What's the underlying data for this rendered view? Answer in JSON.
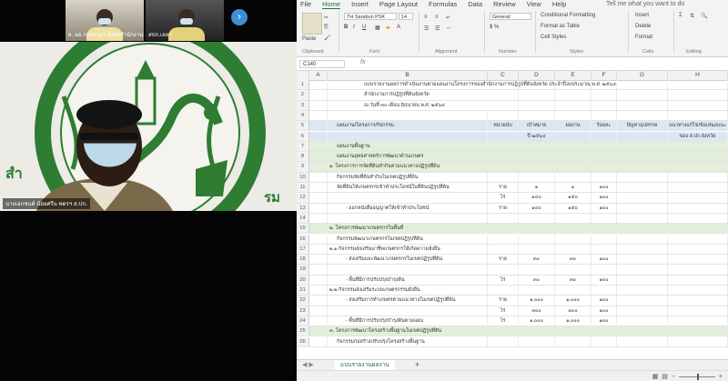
{
  "zoom": {
    "thumbs": [
      {
        "caption": "ผ. ผอ.กรมงานฯ สังกัดสำนักงานฯ"
      },
      {
        "caption": "สปก.เลยฯ"
      }
    ],
    "main_caption": "นายเอกชนค์ น้อยศรีน พดรฯ ส.ปก."
  },
  "excel": {
    "tabs": [
      "File",
      "Home",
      "Insert",
      "Page Layout",
      "Formulas",
      "Data",
      "Review",
      "View",
      "Help"
    ],
    "active_tab": "Home",
    "tell_me": "Tell me what you want to do",
    "font_name": "TH Sarabun PSK",
    "font_size": "14",
    "number_format": "General",
    "paste_label": "Paste",
    "clipboard": "Clipboard",
    "font_group": "Font",
    "alignment": "Alignment",
    "number": "Number",
    "styles": "Styles",
    "cells": "Cells",
    "editing": "Editing",
    "cond_format": "Conditional Formatting",
    "format_table": "Format as Table",
    "cell_styles": "Cell Styles",
    "insert": "Insert",
    "delete": "Delete",
    "format": "Format",
    "name_box": "C140",
    "fx": "fx",
    "columns": [
      "A",
      "B",
      "C",
      "D",
      "E",
      "F",
      "G",
      "H"
    ],
    "rows": [
      {
        "n": "1",
        "b": "แบบรายงานผลการดำเนินงานตามแผนงานโครงการของสำนักงานการปฏิรูปที่ดินจังหวัด ประจำปีงบประมาณ พ.ศ. ๒๕๖๔",
        "c": "",
        "d": "",
        "e": "",
        "f": "",
        "g": "",
        "h": "",
        "cls": ""
      },
      {
        "n": "2",
        "b": "สำนักงานการปฏิรูปที่ดินจังหวัด",
        "c": "",
        "d": "",
        "e": "",
        "f": "",
        "g": "",
        "h": "",
        "cls": ""
      },
      {
        "n": "3",
        "b": "ณ วันที่ ๓๐ เดือน มิถุนายน พ.ศ. ๒๕๖๔",
        "c": "",
        "d": "",
        "e": "",
        "f": "",
        "g": "",
        "h": "",
        "cls": ""
      },
      {
        "n": "4",
        "b": "",
        "c": "",
        "d": "",
        "e": "",
        "f": "",
        "g": "",
        "h": "",
        "cls": ""
      },
      {
        "n": "5",
        "b": "แผนงาน/โครงการ/กิจกรรม",
        "c": "หน่วยนับ",
        "d": "เป้าหมาย",
        "e": "ผลงาน",
        "f": "ร้อยละ",
        "g": "ปัญหาอุปสรรค",
        "h": "แนวทางแก้ไข/ข้อเสนอแนะ",
        "cls": "hl2"
      },
      {
        "n": "6",
        "b": "",
        "c": "",
        "d": "ปี ๒๕๖๔",
        "e": "",
        "f": "",
        "g": "",
        "h": "ของ ส.ปก.จังหวัด",
        "cls": "hl2"
      },
      {
        "n": "7",
        "b": "แผนงานพื้นฐาน",
        "c": "",
        "d": "",
        "e": "",
        "f": "",
        "g": "",
        "h": "",
        "cls": "hl"
      },
      {
        "n": "8",
        "b": "แผนงานยุทธศาสตร์การพัฒนาด้านเกษตร",
        "c": "",
        "d": "",
        "e": "",
        "f": "",
        "g": "",
        "h": "",
        "cls": "hl"
      },
      {
        "n": "9",
        "b": "๑. โครงการการจัดที่ดินทำกินตามแนวทางปฏิรูปที่ดิน",
        "c": "",
        "d": "",
        "e": "",
        "f": "",
        "g": "",
        "h": "",
        "cls": "hl"
      },
      {
        "n": "10",
        "b": "กิจกรรมจัดที่ดินทำกินในเขตปฏิรูปที่ดิน",
        "c": "",
        "d": "",
        "e": "",
        "f": "",
        "g": "",
        "h": "",
        "cls": ""
      },
      {
        "n": "11",
        "b": "จัดที่ดินให้เกษตรกรเข้าทำประโยชน์ในที่ดินปฏิรูปที่ดิน",
        "c": "ราย",
        "d": "๑",
        "e": "๑",
        "f": "๑๐๐",
        "g": "",
        "h": "",
        "cls": ""
      },
      {
        "n": "12",
        "b": "",
        "c": "ไร่",
        "d": "๑๔๐",
        "e": "๑๕๐",
        "f": "๑๐๐",
        "g": "",
        "h": "",
        "cls": ""
      },
      {
        "n": "13",
        "b": "- ออกหนังสืออนุญาตให้เข้าทำประโยชน์",
        "c": "ราย",
        "d": "๑๔๐",
        "e": "๑๕๐",
        "f": "๑๐๐",
        "g": "",
        "h": "",
        "cls": ""
      },
      {
        "n": "14",
        "b": "",
        "c": "",
        "d": "",
        "e": "",
        "f": "",
        "g": "",
        "h": "",
        "cls": ""
      },
      {
        "n": "15",
        "b": "๒. โครงการพัฒนาเกษตรกรในพื้นที่",
        "c": "",
        "d": "",
        "e": "",
        "f": "",
        "g": "",
        "h": "",
        "cls": "hl"
      },
      {
        "n": "16",
        "b": "กิจกรรมพัฒนาเกษตรกรในเขตปฏิรูปที่ดิน",
        "c": "",
        "d": "",
        "e": "",
        "f": "",
        "g": "",
        "h": "",
        "cls": ""
      },
      {
        "n": "17",
        "b": "๒.๑ กิจกรรมส่งเสริมอาชีพเกษตรกรให้เกิดความยั่งยืน",
        "c": "",
        "d": "",
        "e": "",
        "f": "",
        "g": "",
        "h": "",
        "cls": ""
      },
      {
        "n": "18",
        "b": "- ส่งเสริมและพัฒนาเกษตรกรในเขตปฏิรูปที่ดิน",
        "c": "ราย",
        "d": "๓๐",
        "e": "๓๐",
        "f": "๑๐๐",
        "g": "",
        "h": "",
        "cls": ""
      },
      {
        "n": "19",
        "b": "",
        "c": "",
        "d": "",
        "e": "",
        "f": "",
        "g": "",
        "h": "",
        "cls": ""
      },
      {
        "n": "20",
        "b": "- พื้นที่มีการปรับปรุงบำรุงดิน",
        "c": "ไร่",
        "d": "๓๐",
        "e": "๓๐",
        "f": "๑๐๐",
        "g": "",
        "h": "",
        "cls": ""
      },
      {
        "n": "21",
        "b": "๒.๒ กิจกรรมส่งเสริมระบบเกษตรกรรมยั่งยืน",
        "c": "",
        "d": "",
        "e": "",
        "f": "",
        "g": "",
        "h": "",
        "cls": ""
      },
      {
        "n": "22",
        "b": "- ส่งเสริมการทำเกษตรตามแนวทางในเขตปฏิรูปที่ดิน",
        "c": "ราย",
        "d": "๑,๐๐๐",
        "e": "๑,๐๐๐",
        "f": "๑๐๐",
        "g": "",
        "h": "",
        "cls": ""
      },
      {
        "n": "23",
        "b": "",
        "c": "ไร่",
        "d": "๓๐๐",
        "e": "๓๐๐",
        "f": "๑๐๐",
        "g": "",
        "h": "",
        "cls": ""
      },
      {
        "n": "24",
        "b": "- พื้นที่มีการปรับปรุงบำรุงดินตามแผน",
        "c": "ไร่",
        "d": "๑,๐๐๐",
        "e": "๑,๐๐๐",
        "f": "๑๐๐",
        "g": "",
        "h": "",
        "cls": ""
      },
      {
        "n": "25",
        "b": "๓. โครงการพัฒนาโครงสร้างพื้นฐานในเขตปฏิรูปที่ดิน",
        "c": "",
        "d": "",
        "e": "",
        "f": "",
        "g": "",
        "h": "",
        "cls": "hl"
      },
      {
        "n": "26",
        "b": "กิจกรรมก่อสร้างปรับปรุงโครงสร้างพื้นฐาน",
        "c": "",
        "d": "",
        "e": "",
        "f": "",
        "g": "",
        "h": "",
        "cls": ""
      }
    ],
    "sheet_tab": "แบบรายงานผลงาน",
    "add_sheet": "+"
  }
}
